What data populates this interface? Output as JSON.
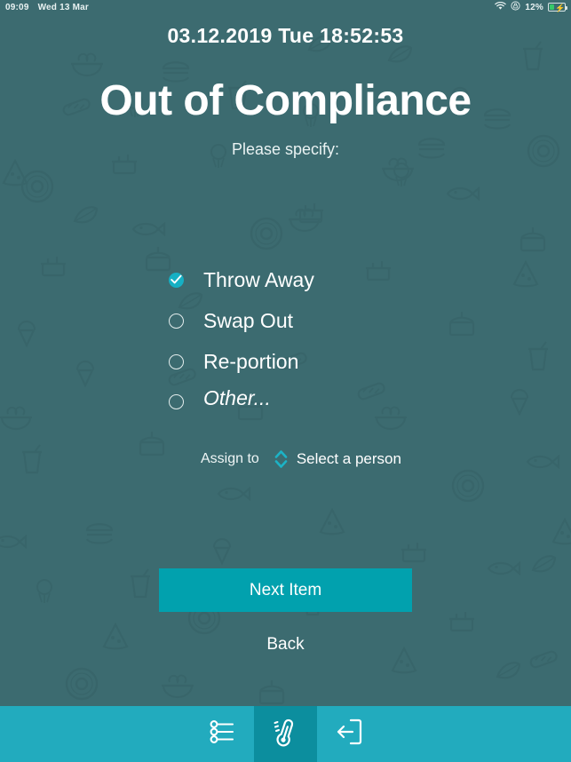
{
  "statusbar": {
    "time": "09:09",
    "date": "Wed 13 Mar",
    "battery_percent": "12%",
    "icons": [
      "wifi-icon",
      "rotation-lock-icon",
      "battery-charging-icon"
    ]
  },
  "header": {
    "datetime": "03.12.2019 Tue 18:52:53"
  },
  "main": {
    "title": "Out of Compliance",
    "subtitle": "Please specify:",
    "options": [
      {
        "label": "Throw Away",
        "selected": true
      },
      {
        "label": "Swap Out",
        "selected": false
      },
      {
        "label": "Re-portion",
        "selected": false
      }
    ],
    "other": {
      "placeholder": "Other...",
      "value": "",
      "selected": false
    },
    "assign": {
      "label": "Assign to",
      "selected_person": "Select a person",
      "stepper_icon": "chevron-up-down-icon"
    },
    "primary_button": "Next Item",
    "secondary_button": "Back"
  },
  "bottom_nav": [
    {
      "name": "checklist",
      "icon": "sliders-list-icon",
      "active": false
    },
    {
      "name": "temperature",
      "icon": "thermometer-icon",
      "active": true
    },
    {
      "name": "logout",
      "icon": "exit-arrow-icon",
      "active": false
    }
  ],
  "colors": {
    "background": "#3c6b70",
    "accent": "#16b0c4",
    "primary_button": "#01a1ae",
    "bottom_bar": "#22abbe",
    "bottom_bar_active": "#0c8e9e",
    "text": "#ffffff"
  }
}
